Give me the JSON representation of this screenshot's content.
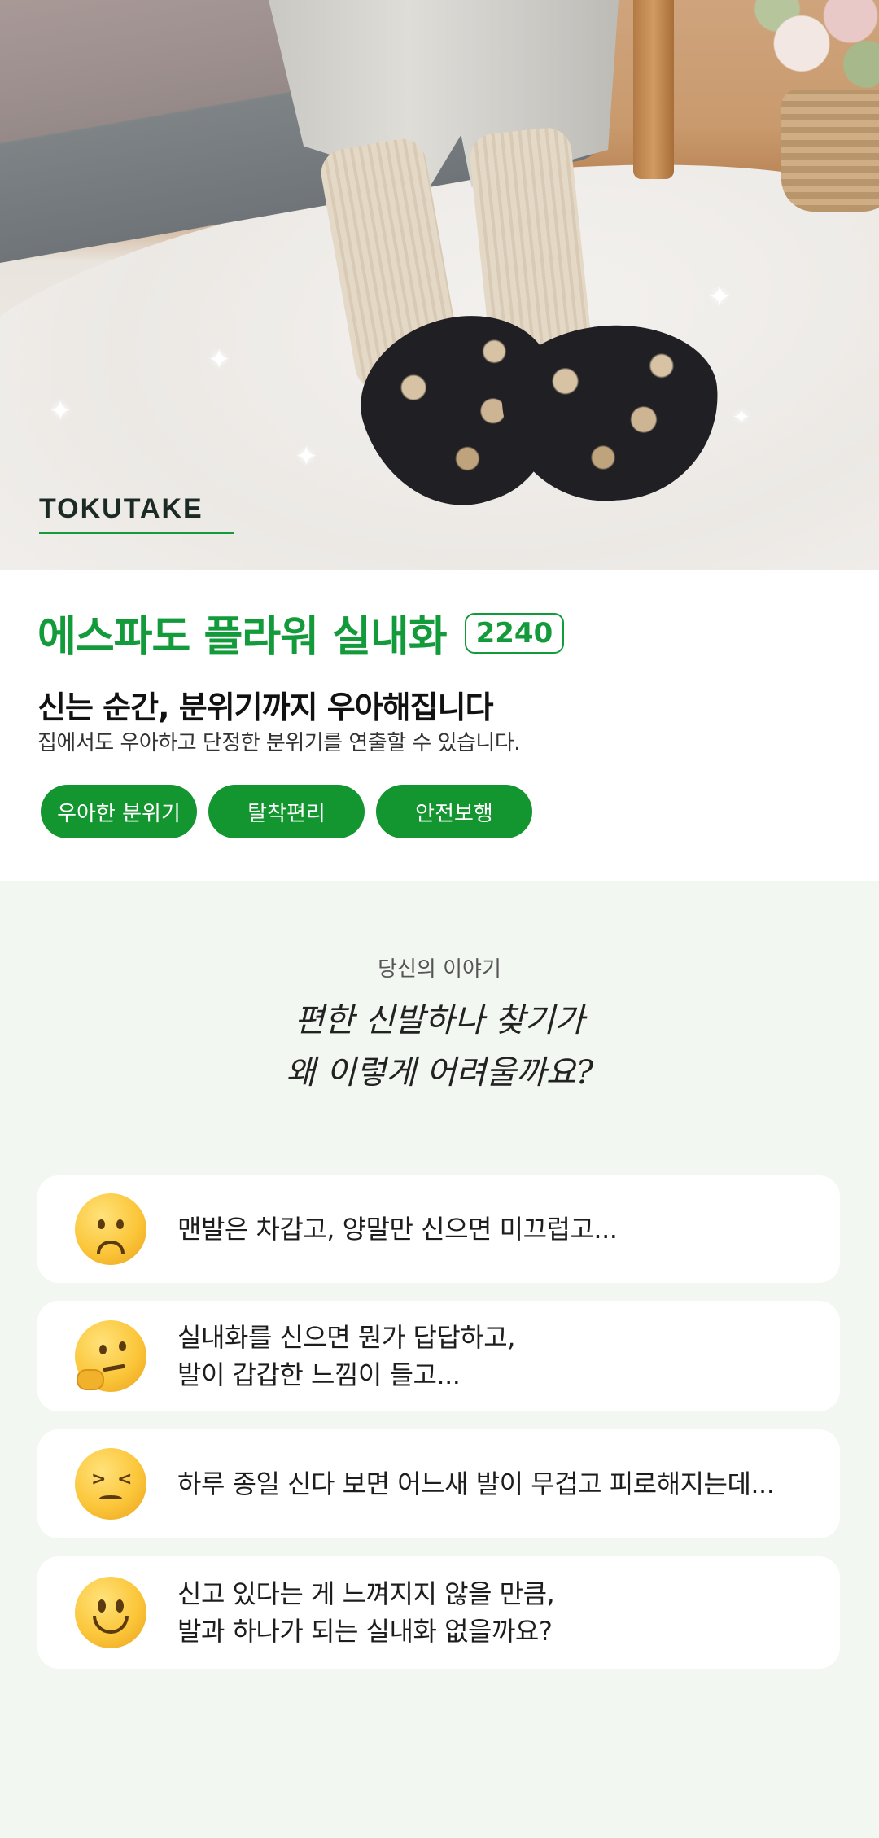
{
  "brand": {
    "logo": "TOKUTAKE",
    "accent": "#139a3a"
  },
  "product": {
    "title": "에스파도 플라워 실내화",
    "code": "2240",
    "headline": "신는 순간, 분위기까지 우아해집니다",
    "subtitle": "집에서도 우아하고 단정한 분위기를 연출할 수 있습니다.",
    "tags": [
      "우아한 분위기",
      "탈착편리",
      "안전보행"
    ]
  },
  "story": {
    "kicker": "당신의 이야기",
    "handwritten": [
      "편한 신발하나 찾기가",
      "왜 이렇게 어려울까요?"
    ],
    "cards": [
      {
        "icon": "frowning-face-icon",
        "lines": [
          "맨발은 차갑고, 양말만 신으면 미끄럽고..."
        ]
      },
      {
        "icon": "thinking-face-icon",
        "lines": [
          "실내화를 신으면 뭔가 답답하고,",
          "발이 갑갑한 느낌이 들고..."
        ]
      },
      {
        "icon": "tired-face-icon",
        "lines": [
          "하루 종일 신다 보면 어느새 발이 무겁고 피로해지는데..."
        ]
      },
      {
        "icon": "smiling-face-icon",
        "lines": [
          "신고 있다는 게 느껴지지 않을 만큼,",
          "발과 하나가 되는 실내화 없을까요?"
        ]
      }
    ]
  }
}
